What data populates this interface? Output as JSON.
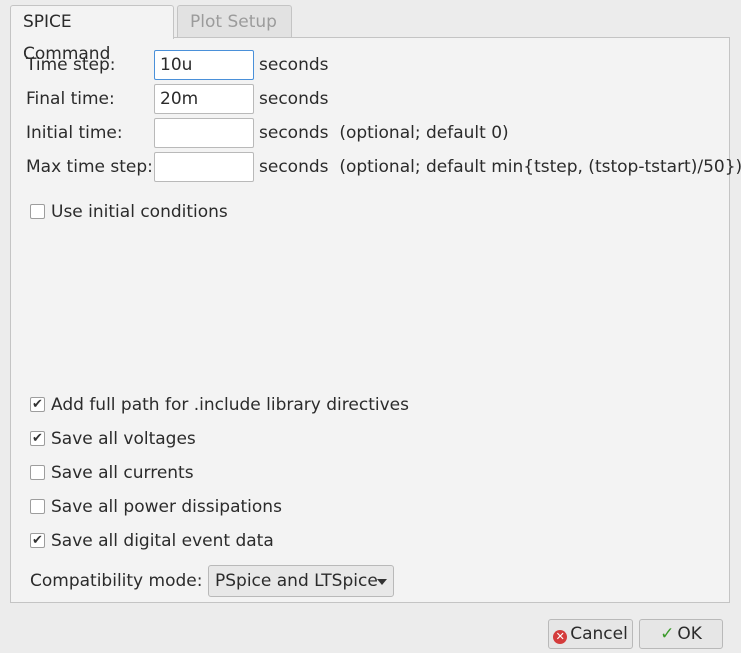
{
  "tabs": [
    {
      "label": "SPICE Command",
      "active": true
    },
    {
      "label": "Plot Setup",
      "active": false
    }
  ],
  "fields": [
    {
      "label": "Time step:",
      "value": "10u",
      "unit": "seconds",
      "note": ""
    },
    {
      "label": "Final time:",
      "value": "20m",
      "unit": "seconds",
      "note": ""
    },
    {
      "label": "Initial time:",
      "value": "",
      "unit": "seconds",
      "note": "(optional; default 0)"
    },
    {
      "label": "Max time step:",
      "value": "",
      "unit": "seconds",
      "note": "(optional; default min{tstep, (tstop-tstart)/50})"
    }
  ],
  "use_initial_conditions": {
    "label": "Use initial conditions",
    "checked": false
  },
  "options": [
    {
      "label": "Add full path for .include library directives",
      "checked": true
    },
    {
      "label": "Save all voltages",
      "checked": true
    },
    {
      "label": "Save all currents",
      "checked": false
    },
    {
      "label": "Save all power dissipations",
      "checked": false
    },
    {
      "label": "Save all digital event data",
      "checked": true
    }
  ],
  "compatibility": {
    "label": "Compatibility mode:",
    "value": "PSpice and LTSpice"
  },
  "buttons": {
    "cancel": "Cancel",
    "ok": "OK"
  },
  "icons": {
    "cancel": "cancel-circle-icon",
    "ok": "checkmark-icon",
    "check": "✔"
  },
  "colors": {
    "cancel_icon": "#d43c3c",
    "ok_icon": "#3a9a2a",
    "focus": "#4a90d9"
  }
}
